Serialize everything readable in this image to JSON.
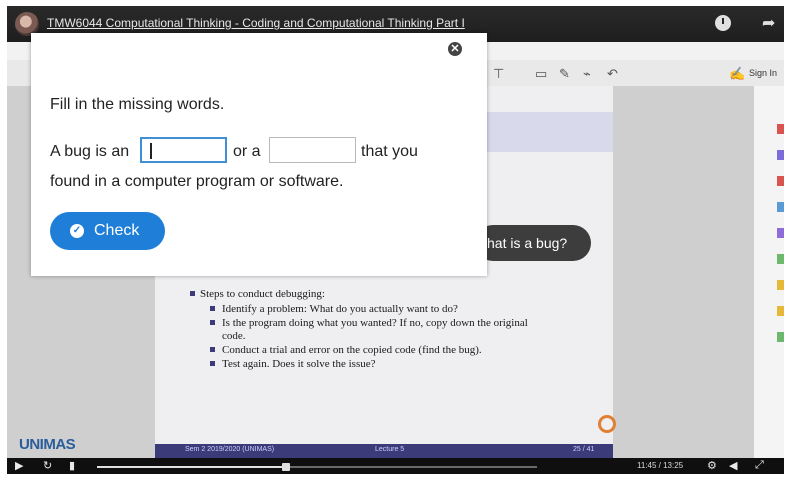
{
  "player": {
    "video_title": "TMW6044 Computational Thinking - Coding and Computational Thinking Part I",
    "time_display": "11:45 / 13:25",
    "progress_fraction": 0.43
  },
  "app": {
    "sign_in": "Sign In"
  },
  "slide": {
    "bubble_text": "hat is a bug?",
    "steps_heading": "Steps to conduct debugging:",
    "steps": [
      "Identify a problem: What do you actually want to do?",
      "Is the program doing what you wanted? If no, copy down the original",
      "code.",
      "Conduct a trial and error on the copied code (find the bug).",
      "Test again. Does it solve the issue?"
    ],
    "footer_left": "Sem 2 2019/2020 (UNIMAS)",
    "footer_mid": "Lecture 5",
    "footer_right": "25 / 41",
    "logo": "UNIMAS"
  },
  "modal": {
    "close_glyph": "✕",
    "instruction": "Fill in the missing words.",
    "sentence_part1": "A bug is an",
    "sentence_part2": "or a",
    "sentence_part3": "that you",
    "sentence_line2": "found in a computer program or software.",
    "blank1_value": "",
    "blank2_value": "",
    "check_label": "Check",
    "check_glyph": "✓"
  },
  "colors": {
    "accent": "#1f7fd8",
    "focus_border": "#3f8fd6"
  }
}
